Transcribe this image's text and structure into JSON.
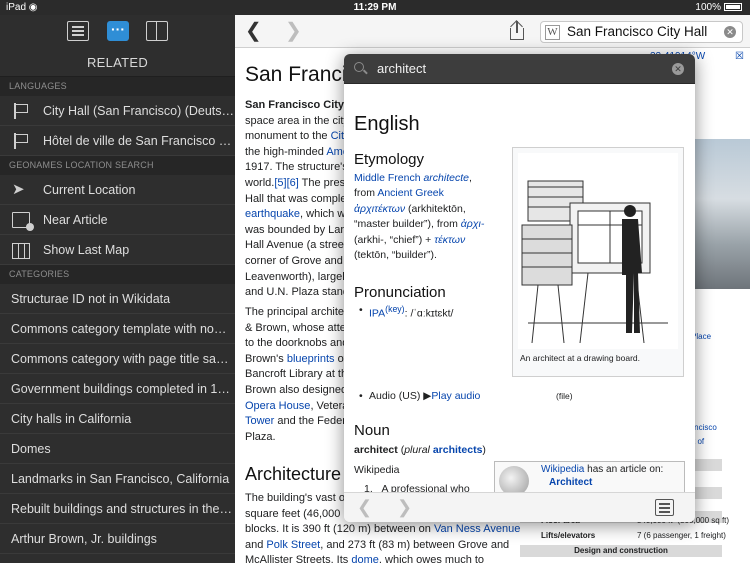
{
  "status_bar": {
    "device": "iPad",
    "time": "11:29 PM",
    "battery": "100%"
  },
  "sidebar": {
    "title": "RELATED",
    "languages_header": "LANGUAGES",
    "languages": [
      "City Hall (San Francisco) (Deutsch)",
      "Hôtel de ville de San Francisco (…"
    ],
    "geonames_header": "GEONAMES LOCATION SEARCH",
    "geonames": [
      "Current Location",
      "Near Article",
      "Show Last Map"
    ],
    "categories_header": "CATEGORIES",
    "categories": [
      "Structurae ID not in Wikidata",
      "Commons category template with no…",
      "Commons category with page title sa…",
      "Government buildings completed in 1…",
      "City halls in California",
      "Domes",
      "Landmarks in San Francisco, California",
      "Rebuilt buildings and structures in the…",
      "Arthur Brown, Jr. buildings"
    ]
  },
  "topnav": {
    "search_value": "San Francisco City Hall"
  },
  "article": {
    "title": "San Franci",
    "coords": "22.41914°W",
    "close_mark": "☒",
    "lines": [
      [
        "San Francisco City H",
        ""
      ],
      [
        "space area in the city'",
        ""
      ],
      [
        "monument to the ",
        "City"
      ],
      [
        "the high-minded ",
        "Ame"
      ],
      [
        "1917. The structure's",
        ""
      ],
      [
        "world.",
        "[5][6]",
        " The preser"
      ],
      [
        "Hall that was complet",
        ""
      ],
      [
        "",
        "earthquake",
        ", which wa"
      ],
      [
        "was bounded by Lark",
        ""
      ],
      [
        "Hall Avenue (a street,",
        ""
      ],
      [
        "corner of Grove and L",
        ""
      ],
      [
        "Leavenworth), largely",
        ""
      ],
      [
        "and U.N. Plaza stand",
        ""
      ]
    ],
    "lines2": [
      [
        "The principal architect",
        ""
      ],
      [
        "& Brown, whose atten",
        ""
      ],
      [
        "to the doorknobs and",
        ""
      ],
      [
        "Brown's ",
        "blueprints",
        " of"
      ],
      [
        "Bancroft Library at the",
        ""
      ],
      [
        "Brown also designed",
        ""
      ],
      [
        "",
        "Opera House",
        ", Veterar"
      ],
      [
        "",
        "Tower",
        " and the Federa"
      ],
      [
        "Plaza.",
        ""
      ]
    ],
    "section_title": "Architecture",
    "lines3": [
      [
        "The building's vast op",
        ""
      ],
      [
        "square feet (46,000 m",
        ""
      ],
      [
        "blocks. It is 390 ft (120 m) between on ",
        "Van Ness Avenue"
      ],
      [
        "and ",
        "Polk Street",
        ", and 273 ft (83 m) between Grove and"
      ],
      [
        "McAllister Streets. Its ",
        "dome",
        ", which owes much to"
      ]
    ],
    "info_links": [
      "Place",
      "rancisco",
      "t of"
    ],
    "info_rows": [
      {
        "k": "Floor area",
        "v": "540,000 ft² (500,000 sq ft)"
      },
      {
        "k": "Lifts/elevators",
        "v": "7 (6 passenger, 1 freight)"
      }
    ],
    "info_band": "Design and construction"
  },
  "dictionary": {
    "query": "architect",
    "language": "English",
    "etymology_heading": "Etymology",
    "etymology_lines": [
      {
        "link": "Middle French ",
        "link_i": "architecte",
        "rest": ","
      },
      {
        "pre": "from ",
        "link": "Ancient Greek"
      },
      {
        "greek": "ἀρχιτέκτων",
        "rest": " (arkhitektōn,"
      },
      {
        "rest": "“master builder”), from ",
        "greek": "ἀρχι-"
      },
      {
        "rest": "(arkhi-, “chief”) + ",
        "greek": "τέκτων"
      },
      {
        "rest": "(tektōn, “builder”)."
      }
    ],
    "pronunciation_heading": "Pronunciation",
    "ipa_label": "IPA",
    "ipa_key": "(key)",
    "ipa_value": ": /ˈɑːkɪtɛkt/",
    "audio_label": "Audio (US)",
    "audio_play": "Play audio",
    "audio_file": "(file)",
    "image_caption": "An architect at a drawing board.",
    "noun_heading": "Noun",
    "noun_word": "architect",
    "noun_plural_label": "plural",
    "noun_plural": "architects",
    "wikipedia_link": "Wikipedia",
    "list_item_1": "A professional who",
    "wiki_box_link": "Wikipedia",
    "wiki_box_text": " has an article on:",
    "wiki_box_target": "Architect"
  }
}
